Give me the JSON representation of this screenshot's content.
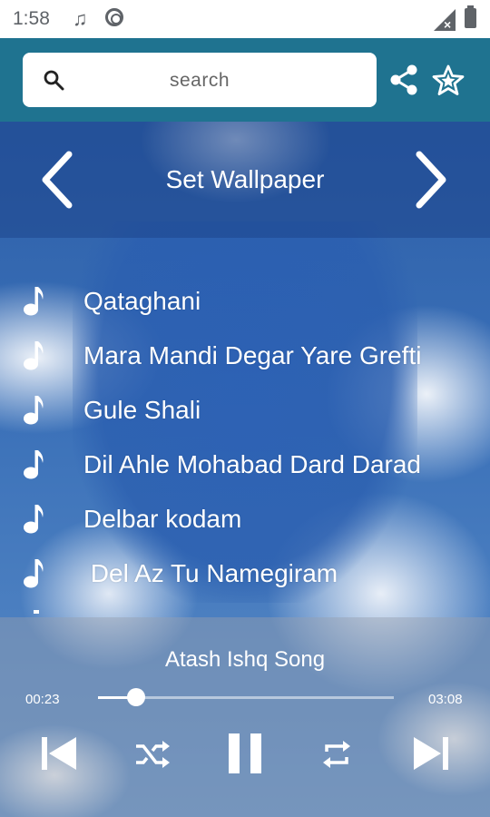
{
  "status_bar": {
    "time": "1:58"
  },
  "header": {
    "search_placeholder": "search"
  },
  "wallpaper_bar": {
    "title": "Set Wallpaper"
  },
  "songs": [
    "Qataghani",
    "Mara Mandi Degar Yare Grefti",
    "Gule Shali",
    "Dil Ahle Mohabad Dard Darad",
    "Delbar kodam",
    " Del Az Tu Namegiram"
  ],
  "player": {
    "now_playing": "Atash Ishq Song",
    "current_time": "00:23",
    "total_time": "03:08",
    "progress_fraction": 0.13
  },
  "colors": {
    "header": "#1f7390",
    "text": "#ffffff"
  }
}
